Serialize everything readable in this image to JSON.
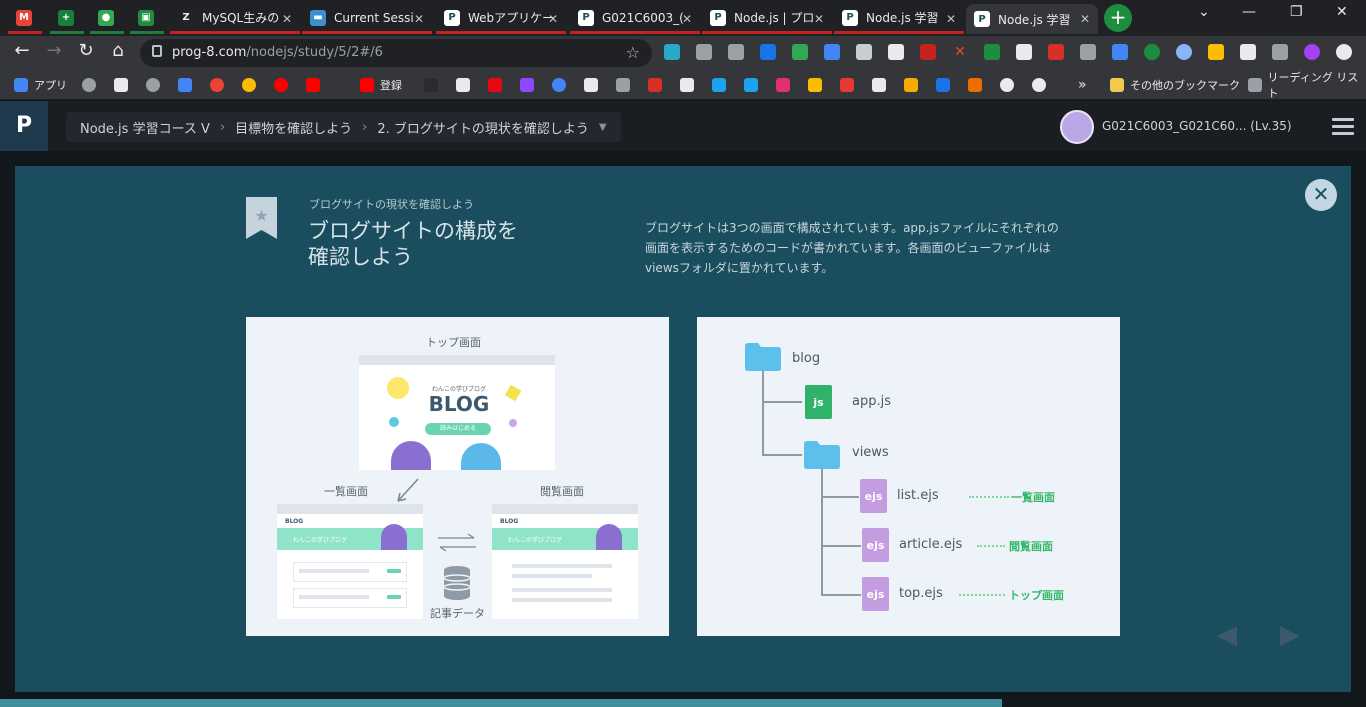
{
  "browser": {
    "tabs": [
      {
        "title": "",
        "favicon": "gmail-icon",
        "color": "#d93025"
      },
      {
        "title": "",
        "favicon": "sheets-icon",
        "color": "#188038"
      },
      {
        "title": "",
        "favicon": "chat-icon",
        "color": "#188038"
      },
      {
        "title": "",
        "favicon": "classroom-icon",
        "color": "#188038"
      },
      {
        "title": "MySQL生みの",
        "favicon": "z-icon"
      },
      {
        "title": "Current Sessi",
        "favicon": "session-icon"
      },
      {
        "title": "Webアプリケー",
        "favicon": "progate-icon"
      },
      {
        "title": "G021C6003_(",
        "favicon": "progate-icon"
      },
      {
        "title": "Node.js | プロ",
        "favicon": "progate-icon"
      },
      {
        "title": "Node.js 学習",
        "favicon": "progate-icon"
      },
      {
        "title": "Node.js 学習",
        "favicon": "progate-icon"
      }
    ],
    "url_host": "prog-8.com",
    "url_path": "/nodejs/study/5/2#/6",
    "bookmarks": [
      "アプリ",
      "登録",
      "その他のブックマーク",
      "リーディング リスト"
    ]
  },
  "appbar": {
    "crumb_course": "Node.js 学習コース V",
    "crumb_goal": "目標物を確認しよう",
    "crumb_step": "2. ブログサイトの現状を確認しよう",
    "username": "G021C6003_G021C60... (Lv.35)"
  },
  "modal": {
    "subtitle": "ブログサイトの現状を確認しよう",
    "title_line1": "ブログサイトの構成を",
    "title_line2": "確認しよう",
    "desc_line1": "ブログサイトは3つの画面で構成されています。app.jsファイルにそれぞれの",
    "desc_line2": "画面を表示するためのコードが書かれています。各画面のビューファイルは",
    "desc_line3": "viewsフォルダに置かれています。"
  },
  "diagram_left": {
    "top_label": "トップ画面",
    "list_label": "一覧画面",
    "article_label": "閲覧画面",
    "blog_title": "BLOG",
    "blog_subtitle": "わんこの学びブログ",
    "read_button": "読みはじめる",
    "blog_small": "BLOG",
    "card_title_left": "わんこの学びブログ",
    "card_title_right": "わんこの学びブログ",
    "db_label": "記事データ"
  },
  "diagram_right": {
    "root": "blog",
    "app": "app.js",
    "views": "views",
    "files": [
      {
        "name": "list.ejs",
        "tag": "一覧画面"
      },
      {
        "name": "article.ejs",
        "tag": "閲覧画面"
      },
      {
        "name": "top.ejs",
        "tag": "トップ画面"
      }
    ],
    "js_badge": "js",
    "ejs_badge": "ejs"
  },
  "colors": {
    "accent": "#1a4e5e",
    "green": "#35b86a",
    "folder": "#5bc0eb",
    "js": "#2fb36a",
    "ejs": "#c39ddf"
  }
}
